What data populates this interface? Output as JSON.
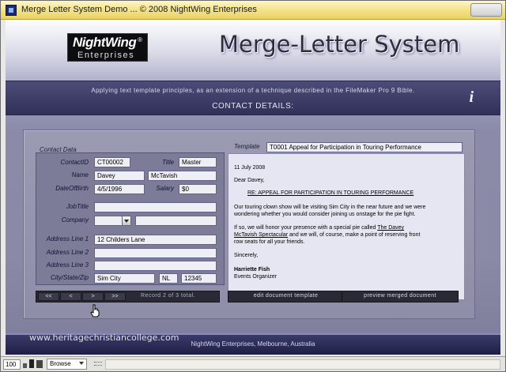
{
  "window": {
    "title": "Merge Letter System Demo   ...   © 2008 NightWing Enterprises"
  },
  "logo": {
    "line1": "NightWing",
    "reg": "®",
    "line2": "Enterprises"
  },
  "header": {
    "app_title": "Merge-Letter System",
    "description": "Applying text template principles, as an extension of a technique described in the FileMaker Pro 9 Bible.",
    "section_title": "CONTACT DETAILS:",
    "info_icon": "info-icon",
    "info_glyph": "i"
  },
  "contact": {
    "group_label": "Contact Data",
    "labels": {
      "contact_id": "ContactID",
      "title": "Title",
      "name": "Name",
      "dob": "DateOfBirth",
      "salary": "Salary",
      "job_title": "JobTitle",
      "company": "Company",
      "address1": "Address Line 1",
      "address2": "Address Line 2",
      "address3": "Address Line 3",
      "city_state_zip": "City/State/Zip"
    },
    "values": {
      "contact_id": "CT00002",
      "title": "Master",
      "first_name": "Davey",
      "last_name": "McTavish",
      "dob": "4/5/1996",
      "salary": "$0",
      "job_title": "",
      "company": "",
      "company_extra": "",
      "address1": "12 Childers Lane",
      "address2": "",
      "address3": "",
      "city": "Sim City",
      "state": "NL",
      "zip": "12345"
    }
  },
  "template": {
    "label": "Template",
    "value": "T0001 Appeal for Participation in Touring Performance"
  },
  "letter": {
    "date": "11 July 2008",
    "salutation": "Dear Davey,",
    "subject": "RE: APPEAL FOR PARTICIPATION IN TOURING PERFORMANCE",
    "para1_line1": "Our touring clown show will be visiting Sim City in the near future and we were",
    "para1_line2": "wondering whether you would consider joining us onstage for the pie fight.",
    "para2_line1_pre": "If so, we will honor your presence with a special pie called ",
    "para2_line1_link": "The Davey",
    "para2_line2_link": "McTavish Spectacular",
    "para2_line2_post": " and we will, of course, make a point of reserving front",
    "para2_line3": "row seats for all your friends.",
    "closing": "Sincerely,",
    "signer": "Harriette Fish",
    "signer_title": "Events Organizer"
  },
  "navigation": {
    "first": "<<",
    "prev": "<",
    "next": ">",
    "last": ">>",
    "record_status": "Record 2 of 3 total."
  },
  "actions": {
    "edit_template": "edit document template",
    "preview": "preview merged document"
  },
  "footer": {
    "watermark": "www.heritagechristiancollege.com",
    "text": "NightWing Enterprises, Melbourne, Australia"
  },
  "statusbar": {
    "zoom": "100",
    "mode": "Browse"
  }
}
